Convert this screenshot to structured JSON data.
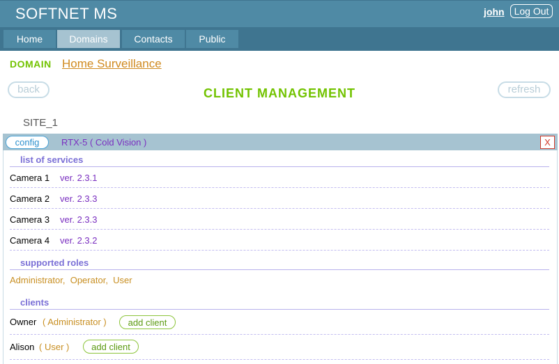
{
  "app": {
    "title": "SOFTNET MS",
    "user": "john",
    "logout_label": "Log Out"
  },
  "nav": {
    "tabs": [
      {
        "label": "Home"
      },
      {
        "label": "Domains"
      },
      {
        "label": "Contacts"
      },
      {
        "label": "Public"
      }
    ],
    "active": "Domains"
  },
  "domain": {
    "label": "DOMAIN",
    "name": "Home Surveillance"
  },
  "page": {
    "title": "CLIENT MANAGEMENT",
    "back_label": "back",
    "refresh_label": "refresh"
  },
  "site": {
    "name": "SITE_1"
  },
  "device": {
    "config_label": "config",
    "model": "RTX-5",
    "vendor": "Cold Vision",
    "close_label": "X"
  },
  "services": {
    "header": "list of services",
    "items": [
      {
        "name": "Camera 1",
        "version": "ver. 2.3.1"
      },
      {
        "name": "Camera 2",
        "version": "ver. 2.3.3"
      },
      {
        "name": "Camera 3",
        "version": "ver. 2.3.3"
      },
      {
        "name": "Camera 4",
        "version": "ver. 2.3.2"
      }
    ]
  },
  "roles": {
    "header": "supported roles",
    "items": [
      "Administrator",
      "Operator",
      "User"
    ]
  },
  "clients": {
    "header": "clients",
    "add_label": "add client",
    "items": [
      {
        "name": "Owner",
        "role": "Administrator"
      },
      {
        "name": "Alison",
        "role": "User"
      }
    ]
  },
  "colors": {
    "header_bg": "#4f8aa5",
    "nav_bg": "#3f7590",
    "active_tab": "#a6c3d1",
    "accent_green": "#72c300",
    "link_orange": "#d08a1f",
    "purple": "#7a2fc0"
  }
}
